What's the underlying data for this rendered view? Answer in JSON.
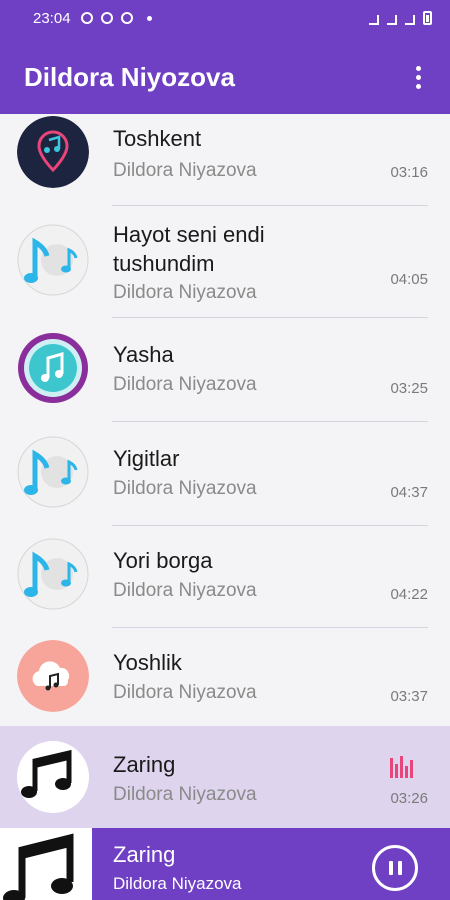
{
  "status": {
    "time": "23:04"
  },
  "appbar": {
    "title": "Dildora Niyozova"
  },
  "songs": [
    {
      "title": "Toshkent",
      "artist": "Dildora Niyazova",
      "duration": "03:16",
      "icon": "music-pin-icon"
    },
    {
      "title": "Hayot seni endi",
      "title2": "tushundim",
      "artist": "Dildora Niyazova",
      "duration": "04:05",
      "icon": "music-notes-disc-icon"
    },
    {
      "title": "Yasha",
      "artist": "Dildora Niyazova",
      "duration": "03:25",
      "icon": "music-note-badge-icon"
    },
    {
      "title": "Yigitlar",
      "artist": "Dildora Niyazova",
      "duration": "04:37",
      "icon": "music-notes-disc-icon"
    },
    {
      "title": "Yori borga",
      "artist": "Dildora Niyazova",
      "duration": "04:22",
      "icon": "music-notes-disc-icon"
    },
    {
      "title": "Yoshlik",
      "artist": "Dildora Niyazova",
      "duration": "03:37",
      "icon": "cloud-music-icon"
    },
    {
      "title": "Zaring",
      "artist": "Dildora Niyazova",
      "duration": "03:26",
      "icon": "music-notes-black-icon",
      "playing": true
    }
  ],
  "now_playing": {
    "title": "Zaring",
    "artist": "Dildora Niyazova"
  },
  "colors": {
    "primary": "#6f3fc4",
    "active_row": "#ded4ee",
    "eq_accent": "#e8457a"
  }
}
